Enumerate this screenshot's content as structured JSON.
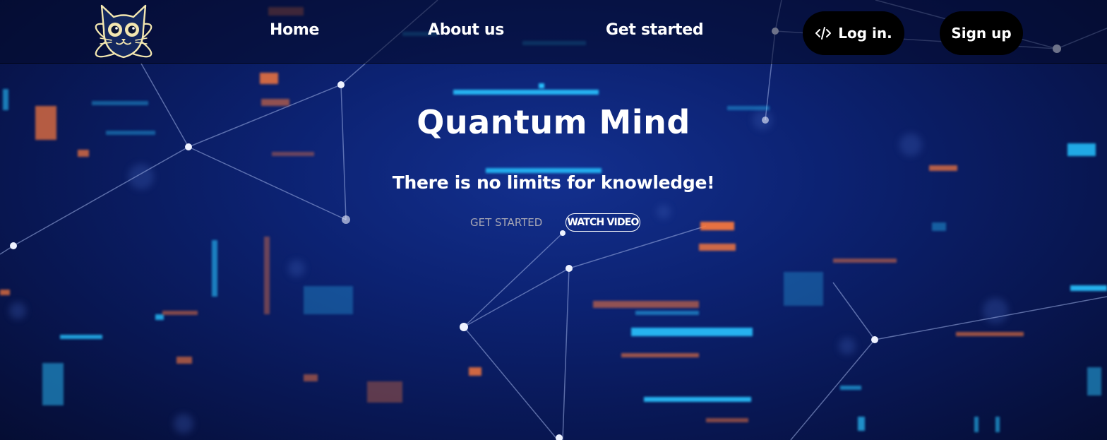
{
  "nav": {
    "logo_icon": "cat-atom-logo-icon",
    "links": [
      {
        "label": "Home"
      },
      {
        "label": "About us"
      },
      {
        "label": "Get started"
      }
    ],
    "login_label": "Log in.",
    "login_icon": "code-brackets-icon",
    "signup_label": "Sign up"
  },
  "hero": {
    "title": "Quantum Mind",
    "subtitle": "There is no limits for knowledge!",
    "get_started_label": "GET STARTED",
    "watch_video_label": "WATCH VIDEO"
  },
  "colors": {
    "background": "#0c2272",
    "navbar": "#040a28",
    "button": "#000000",
    "text": "#ffffff",
    "muted_text": "#a6a6b4",
    "accent_blue": "#27c3ff",
    "accent_orange": "#ff7a3c"
  }
}
